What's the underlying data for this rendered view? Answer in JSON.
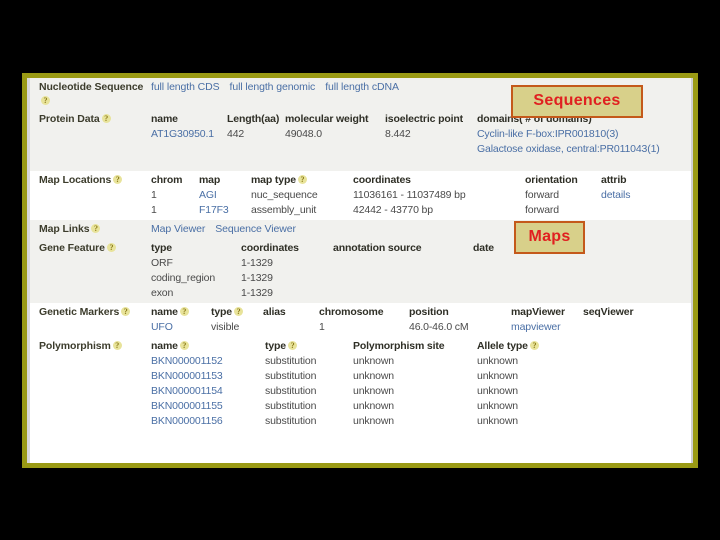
{
  "callouts": {
    "sequences": "Sequences",
    "maps": "Maps"
  },
  "rows": {
    "nucleotide_sequence": {
      "label": "Nucleotide Sequence",
      "links": [
        "full length CDS",
        "full length genomic",
        "full length cDNA"
      ]
    },
    "protein_data": {
      "label": "Protein Data",
      "headers": [
        "name",
        "Length(aa)",
        "molecular weight",
        "isoelectric point",
        "domains( # of domains)"
      ],
      "row": {
        "name": "AT1G30950.1",
        "length": "442",
        "molecular_weight": "49048.0",
        "isoelectric_point": "8.442",
        "domains": [
          "Cyclin-like F-box:IPR001810(3)",
          "Galactose oxidase, central:PR011043(1)"
        ]
      }
    },
    "map_locations": {
      "label": "Map Locations",
      "headers": [
        "chrom",
        "map",
        "map type",
        "coordinates",
        "orientation",
        "attrib"
      ],
      "rows": [
        {
          "chrom": "1",
          "map": "AGI",
          "map_type": "nuc_sequence",
          "coordinates": "11036161 - 11037489 bp",
          "orientation": "forward",
          "attrib": "details"
        },
        {
          "chrom": "1",
          "map": "F17F3",
          "map_type": "assembly_unit",
          "coordinates": "42442 - 43770 bp",
          "orientation": "forward",
          "attrib": ""
        }
      ]
    },
    "map_links": {
      "label": "Map Links",
      "links": [
        "Map Viewer",
        "Sequence Viewer"
      ]
    },
    "gene_feature": {
      "label": "Gene Feature",
      "headers": [
        "type",
        "coordinates",
        "annotation source",
        "date"
      ],
      "rows": [
        {
          "type": "ORF",
          "coordinates": "1-1329",
          "annotation_source": "",
          "date": ""
        },
        {
          "type": "coding_region",
          "coordinates": "1-1329",
          "annotation_source": "",
          "date": ""
        },
        {
          "type": "exon",
          "coordinates": "1-1329",
          "annotation_source": "",
          "date": ""
        }
      ]
    },
    "genetic_markers": {
      "label": "Genetic Markers",
      "headers": [
        "name",
        "type",
        "alias",
        "chromosome",
        "position",
        "mapViewer",
        "seqViewer"
      ],
      "rows": [
        {
          "name": "UFO",
          "type": "visible",
          "alias": "",
          "chromosome": "1",
          "position": "46.0-46.0 cM",
          "map_viewer": "mapviewer",
          "seq_viewer": ""
        }
      ]
    },
    "polymorphism": {
      "label": "Polymorphism",
      "headers": [
        "name",
        "type",
        "Polymorphism site",
        "Allele type"
      ],
      "rows": [
        {
          "name": "BKN000001152",
          "type": "substitution",
          "site": "unknown",
          "allele_type": "unknown"
        },
        {
          "name": "BKN000001153",
          "type": "substitution",
          "site": "unknown",
          "allele_type": "unknown"
        },
        {
          "name": "BKN000001154",
          "type": "substitution",
          "site": "unknown",
          "allele_type": "unknown"
        },
        {
          "name": "BKN000001155",
          "type": "substitution",
          "site": "unknown",
          "allele_type": "unknown"
        },
        {
          "name": "BKN000001156",
          "type": "substitution",
          "site": "unknown",
          "allele_type": "unknown"
        }
      ]
    }
  },
  "colors": {
    "frame_border": "#9a9a14",
    "callout_bg": "#d8d08a",
    "callout_border": "#c4591a",
    "callout_text": "#e02020",
    "link": "#4a6fa5",
    "label_text": "#3c3c2c",
    "row_shade": "#f1f1ee",
    "background": "#000000"
  }
}
